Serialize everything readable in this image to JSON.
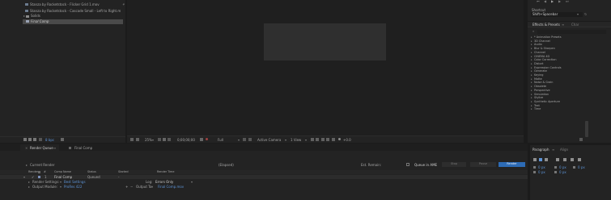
{
  "project": {
    "items": [
      {
        "label": "Stanza by Rocketstock - Flicker Grid 1.mov"
      },
      {
        "label": "Stanza by Rocketstock - Cascade Small - Left to Right.m"
      },
      {
        "label": "Solids"
      },
      {
        "label": "Final Comp"
      }
    ],
    "bpc": "8 bpc"
  },
  "viewer": {
    "zoom": "25%",
    "timecode": "0;00;00;00",
    "resolution": "Full",
    "camera": "Active Camera",
    "view": "1 View",
    "exposure": "+0.0"
  },
  "shortcut": {
    "title": "Shortcut",
    "value": "Shift+Spacebar"
  },
  "effects": {
    "tab": "Effects & Presets",
    "tab2": "Char",
    "items": [
      "* Animation Presets",
      "3D Channel",
      "Audio",
      "Blur & Sharpen",
      "Channel",
      "CINEMA 4D",
      "Color Correction",
      "Distort",
      "Expression Controls",
      "Generate",
      "Keying",
      "Matte",
      "Noise & Grain",
      "Obsolete",
      "Perspective",
      "Simulation",
      "Stylize",
      "Synthetic Aperture",
      "Text",
      "Time"
    ]
  },
  "render_queue": {
    "tab1": "Render Queue",
    "tab2": "Final Comp",
    "current_render": "Current Render",
    "elapsed": "(Elapsed)",
    "est_remain": "Est. Remain:",
    "queue_ame": "Queue in AME",
    "stop": "Stop",
    "pause": "Pause",
    "render": "Render",
    "columns": [
      "Render",
      "#",
      "Comp Name",
      "Status",
      "Started",
      "Render Time"
    ],
    "item": {
      "num": "1",
      "comp": "Final Comp",
      "status": "Queued",
      "started": "-",
      "render_settings_label": "Render Settings:",
      "render_settings_value": "Best Settings",
      "output_module_label": "Output Module:",
      "output_module_value": "ProRes 422",
      "log_label": "Log:",
      "log_value": "Errors Only",
      "output_to_label": "Output To:",
      "output_to_value": "Final Comp.mov"
    }
  },
  "paragraph": {
    "tab": "Paragraph",
    "tab2": "Align",
    "v1": "0 px",
    "v2": "0 px",
    "v3": "0 px",
    "v4": "0 px",
    "v5": "0 px"
  },
  "colors": {
    "accent": "#2d6bb5",
    "link": "#5d93d6",
    "panel": "#232323",
    "bg": "#1b1b1b"
  }
}
